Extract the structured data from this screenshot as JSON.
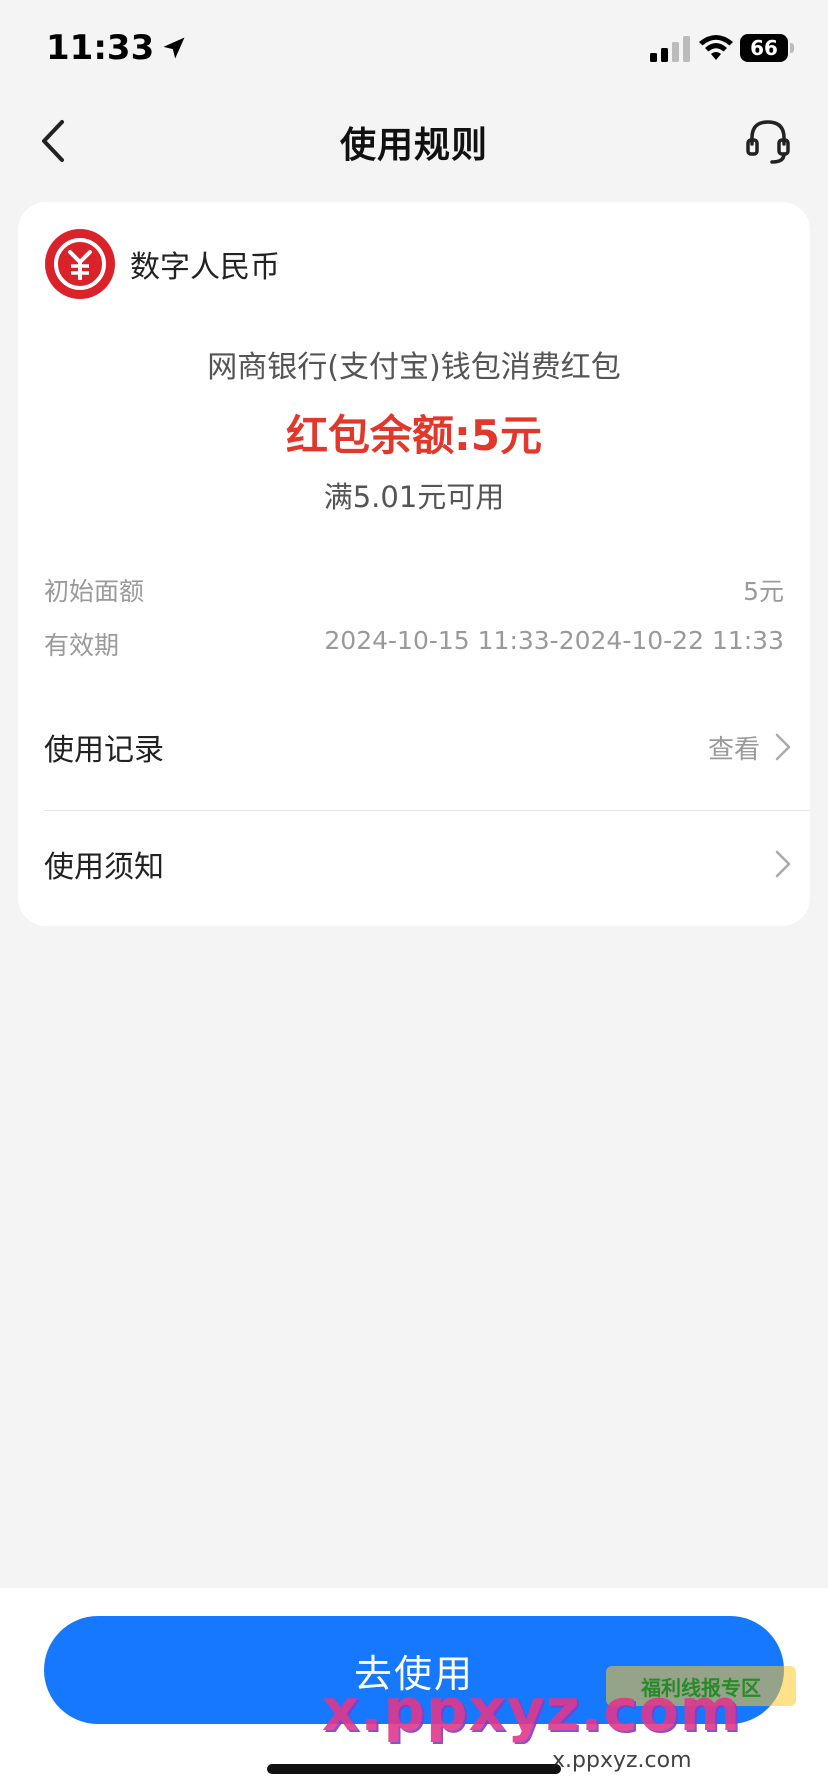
{
  "status_bar": {
    "time": "11:33",
    "battery": "66"
  },
  "nav": {
    "title": "使用规则"
  },
  "card": {
    "brand_name": "数字人民币",
    "coupon_description": "网商银行(支付宝)钱包消费红包",
    "balance": "红包余额:5元",
    "condition": "满5.01元可用",
    "details": {
      "initial_label": "初始面额",
      "initial_value": "5元",
      "validity_label": "有效期",
      "validity_value": "2024-10-15 11:33-2024-10-22 11:33"
    },
    "menu": {
      "record_label": "使用记录",
      "record_action": "查看",
      "notice_label": "使用须知"
    }
  },
  "bottom": {
    "use_button": "去使用"
  },
  "watermark": {
    "main": "x.ppxyz.com",
    "sub": "x.ppxyz.com",
    "badge": "福利线报专区"
  },
  "colors": {
    "accent_blue": "#1677ff",
    "balance_red": "#e2382b",
    "logo_red": "#d9222a"
  }
}
